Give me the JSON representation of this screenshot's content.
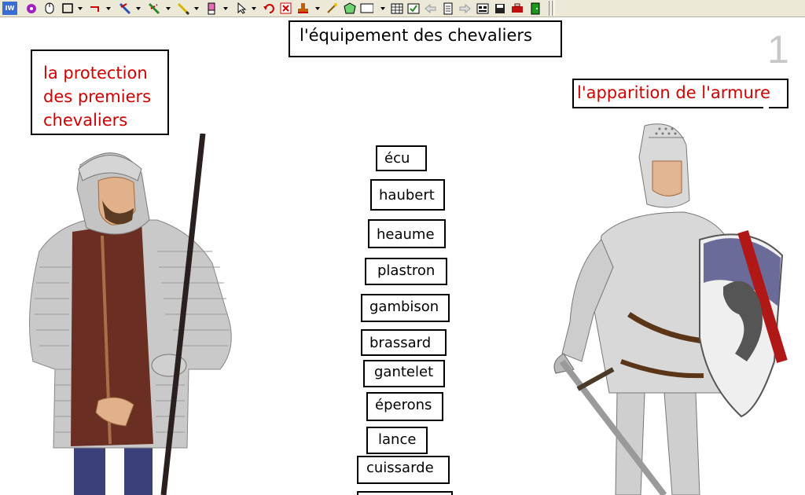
{
  "toolbar": {
    "app_badge": "IW",
    "icons": [
      "app-logo-icon",
      "pointer-icon",
      "mouse-icon",
      "rectangle-icon",
      "connector-icon",
      "pen-icon",
      "highlighter-icon",
      "pencil-icon",
      "eraser-icon",
      "select-arrow-icon",
      "undo-icon",
      "delete-icon",
      "stamp-icon",
      "magic-wand-icon",
      "shape-icon",
      "text-box-icon",
      "table-icon",
      "image-icon",
      "back-icon",
      "page-icon",
      "forward-icon",
      "layout-icon",
      "save-icon",
      "toolbox-icon",
      "exit-icon"
    ]
  },
  "page": {
    "title": "l'équipement des chevaliers",
    "number": "1"
  },
  "headings": {
    "left": "la protection des premiers chevaliers",
    "right": "l'apparition de l'armure"
  },
  "words": [
    "écu",
    "haubert",
    "heaume",
    "plastron",
    "gambison",
    "brassard",
    "gantelet",
    "éperons",
    "lance",
    "cuissarde",
    ""
  ],
  "colors": {
    "heading_text": "#d00000",
    "toolbar_bg": "#ece9d8",
    "page_number": "#c8c8c8"
  }
}
